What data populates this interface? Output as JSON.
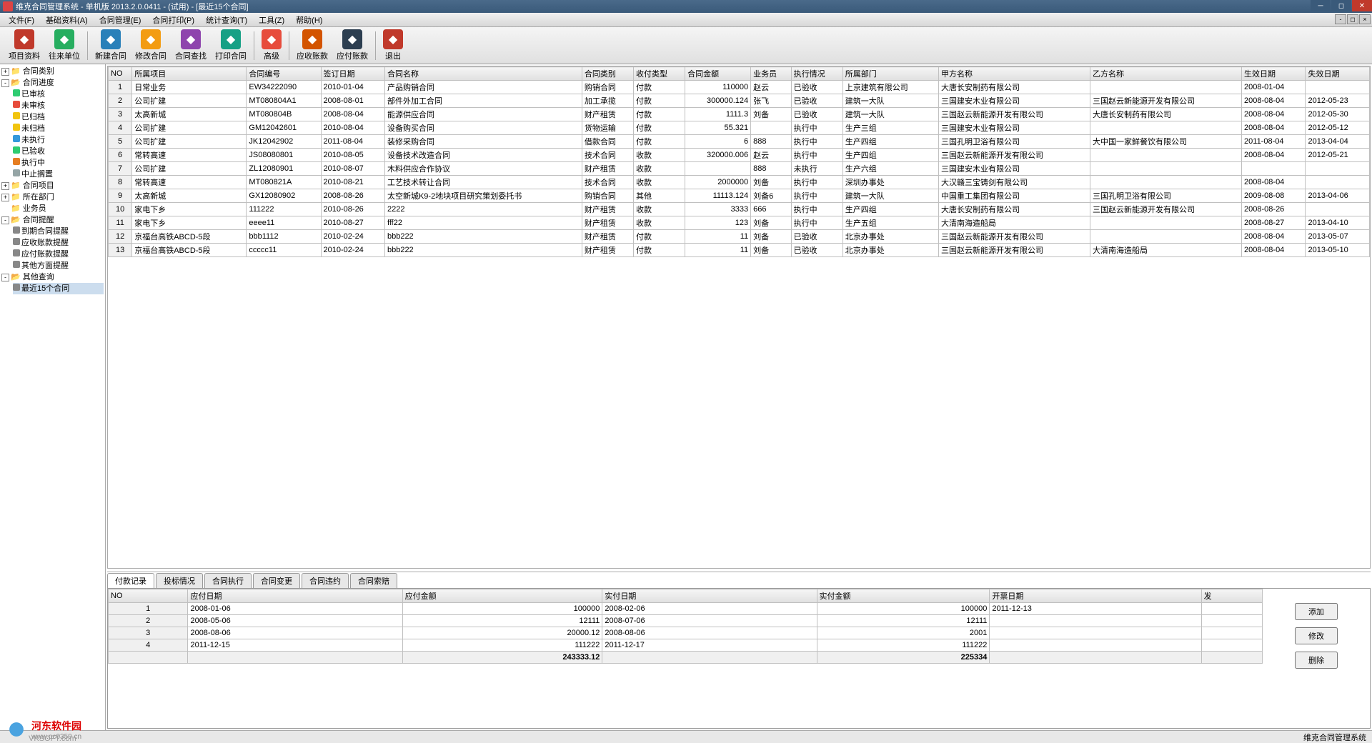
{
  "title": "维克合同管理系统 - 单机版 2013.2.0.0411 - (试用) - [最近15个合同]",
  "menu": [
    "文件(F)",
    "基础资料(A)",
    "合同管理(E)",
    "合同打印(P)",
    "统计查询(T)",
    "工具(Z)",
    "帮助(H)"
  ],
  "toolbar": [
    {
      "label": "项目资料",
      "color": "#c0392b"
    },
    {
      "label": "往来单位",
      "color": "#27ae60"
    },
    {
      "label": "新建合同",
      "color": "#2980b9"
    },
    {
      "label": "修改合同",
      "color": "#f39c12"
    },
    {
      "label": "合同查找",
      "color": "#8e44ad"
    },
    {
      "label": "打印合同",
      "color": "#16a085"
    },
    {
      "label": "高级",
      "color": "#e74c3c"
    },
    {
      "label": "应收账款",
      "color": "#d35400"
    },
    {
      "label": "应付账款",
      "color": "#2c3e50"
    },
    {
      "label": "退出",
      "color": "#c0392b"
    }
  ],
  "tree": [
    {
      "label": "合同类别",
      "exp": "+",
      "icon": "📁"
    },
    {
      "label": "合同进度",
      "exp": "-",
      "icon": "📂",
      "children": [
        {
          "label": "已审核",
          "color": "#2ecc71"
        },
        {
          "label": "未审核",
          "color": "#e74c3c"
        },
        {
          "label": "已归档",
          "color": "#f1c40f"
        },
        {
          "label": "未归档",
          "color": "#f1c40f"
        },
        {
          "label": "未执行",
          "color": "#3498db"
        },
        {
          "label": "已验收",
          "color": "#2ecc71"
        },
        {
          "label": "执行中",
          "color": "#e67e22"
        },
        {
          "label": "中止搁置",
          "color": "#95a5a6"
        }
      ]
    },
    {
      "label": "合同项目",
      "exp": "+",
      "icon": "📁"
    },
    {
      "label": "所在部门",
      "exp": "+",
      "icon": "📁"
    },
    {
      "label": "业务员",
      "exp": "",
      "icon": "📁"
    },
    {
      "label": "合同提醒",
      "exp": "-",
      "icon": "📂",
      "children": [
        {
          "label": "到期合同提醒",
          "color": "#888"
        },
        {
          "label": "应收账款提醒",
          "color": "#888"
        },
        {
          "label": "应付账款提醒",
          "color": "#888"
        },
        {
          "label": "其他方面提醒",
          "color": "#888"
        }
      ]
    },
    {
      "label": "其他查询",
      "exp": "-",
      "icon": "📂",
      "children": [
        {
          "label": "最近15个合同",
          "color": "#888",
          "selected": true
        }
      ]
    }
  ],
  "columns": [
    "NO",
    "所属项目",
    "合同编号",
    "签订日期",
    "合同名称",
    "合同类别",
    "收付类型",
    "合同金额",
    "业务员",
    "执行情况",
    "所属部门",
    "甲方名称",
    "乙方名称",
    "生效日期",
    "失效日期"
  ],
  "rows": [
    [
      "1",
      "日常业务",
      "EW34222090",
      "2010-01-04",
      "产品购销合同",
      "购销合同",
      "付款",
      "110000",
      "赵云",
      "已验收",
      "上京建筑有限公司",
      "大唐长安制药有限公司",
      "",
      "2008-01-04",
      ""
    ],
    [
      "2",
      "公司扩建",
      "MT080804A1",
      "2008-08-01",
      "部件外加工合同",
      "加工承揽",
      "付款",
      "300000.124",
      "张飞",
      "已验收",
      "建筑一大队",
      "三国建安木业有限公司",
      "三国赵云新能源开发有限公司",
      "2008-08-04",
      "2012-05-23"
    ],
    [
      "3",
      "太高新城",
      "MT080804B",
      "2008-08-04",
      "能源供应合同",
      "财产租赁",
      "付款",
      "1111.3",
      "刘备",
      "已验收",
      "建筑一大队",
      "三国赵云新能源开发有限公司",
      "大唐长安制药有限公司",
      "2008-08-04",
      "2012-05-30"
    ],
    [
      "4",
      "公司扩建",
      "GM12042601",
      "2010-08-04",
      "设备购买合同",
      "货物运输",
      "付款",
      "55.321",
      "",
      "执行中",
      "生产三组",
      "三国建安木业有限公司",
      "",
      "2008-08-04",
      "2012-05-12"
    ],
    [
      "5",
      "公司扩建",
      "JK12042902",
      "2011-08-04",
      "装修采购合同",
      "借款合同",
      "付款",
      "6",
      "888",
      "执行中",
      "生产四组",
      "三国孔明卫浴有限公司",
      "大中国一家鲜餐饮有限公司",
      "2011-08-04",
      "2013-04-04"
    ],
    [
      "6",
      "常转高速",
      "JS08080801",
      "2010-08-05",
      "设备技术改造合同",
      "技术合同",
      "收款",
      "320000.006",
      "赵云",
      "执行中",
      "生产四组",
      "三国赵云新能源开发有限公司",
      "",
      "2008-08-04",
      "2012-05-21"
    ],
    [
      "7",
      "公司扩建",
      "ZL12080901",
      "2010-08-07",
      "木料供应合作协议",
      "财产租赁",
      "收款",
      "",
      "888",
      "未执行",
      "生产六组",
      "三国建安木业有限公司",
      "",
      "",
      ""
    ],
    [
      "8",
      "常转高速",
      "MT080821A",
      "2010-08-21",
      "工艺技术转让合同",
      "技术合同",
      "收款",
      "2000000",
      "刘备",
      "执行中",
      "深圳办事处",
      "大汉赣三宝铸剑有限公司",
      "",
      "2008-08-04",
      ""
    ],
    [
      "9",
      "太高新城",
      "GX12080902",
      "2008-08-26",
      "太空新城K9-2地块项目研究策划委托书",
      "购销合同",
      "其他",
      "11113.124",
      "刘备6",
      "执行中",
      "建筑一大队",
      "中国重工集团有限公司",
      "三国孔明卫浴有限公司",
      "2009-08-08",
      "2013-04-06"
    ],
    [
      "10",
      "家电下乡",
      "111222",
      "2010-08-26",
      "2222",
      "财产租赁",
      "收款",
      "3333",
      "666",
      "执行中",
      "生产四组",
      "大唐长安制药有限公司",
      "三国赵云新能源开发有限公司",
      "2008-08-26",
      ""
    ],
    [
      "11",
      "家电下乡",
      "eeee11",
      "2010-08-27",
      "fff22",
      "财产租赁",
      "收款",
      "123",
      "刘备",
      "执行中",
      "生产五组",
      "大清南海造船局",
      "",
      "2008-08-27",
      "2013-04-10"
    ],
    [
      "12",
      "京福台高铁ABCD-5段",
      "bbb1112",
      "2010-02-24",
      "bbb222",
      "财产租赁",
      "付款",
      "11",
      "刘备",
      "已验收",
      "北京办事处",
      "三国赵云新能源开发有限公司",
      "",
      "2008-08-04",
      "2013-05-07"
    ],
    [
      "13",
      "京福台高铁ABCD-5段",
      "ccccc11",
      "2010-02-24",
      "bbb222",
      "财产租赁",
      "付款",
      "11",
      "刘备",
      "已验收",
      "北京办事处",
      "三国赵云新能源开发有限公司",
      "大清南海造船局",
      "2008-08-04",
      "2013-05-10"
    ]
  ],
  "tabs": [
    "付款记录",
    "投标情况",
    "合同执行",
    "合同变更",
    "合同违约",
    "合同索赔"
  ],
  "activeTab": 0,
  "payColumns": [
    "NO",
    "应付日期",
    "应付金额",
    "实付日期",
    "实付金额",
    "开票日期",
    "发"
  ],
  "payRows": [
    [
      "1",
      "2008-01-06",
      "100000",
      "2008-02-06",
      "100000",
      "2011-12-13",
      ""
    ],
    [
      "2",
      "2008-05-06",
      "12111",
      "2008-07-06",
      "12111",
      "",
      ""
    ],
    [
      "3",
      "2008-08-06",
      "20000.12",
      "2008-08-06",
      "2001",
      "",
      ""
    ],
    [
      "4",
      "2011-12-15",
      "111222",
      "2011-12-17",
      "111222",
      "",
      ""
    ]
  ],
  "payTotals": [
    "",
    "",
    "243333.12",
    "",
    "225334",
    "",
    ""
  ],
  "btns": {
    "add": "添加",
    "edit": "修改",
    "del": "删除"
  },
  "status": "维克合同管理系统",
  "watermark": {
    "name": "河东软件园",
    "url": "www.pc0359.cn"
  },
  "vksoft": "VKSOFT.com"
}
